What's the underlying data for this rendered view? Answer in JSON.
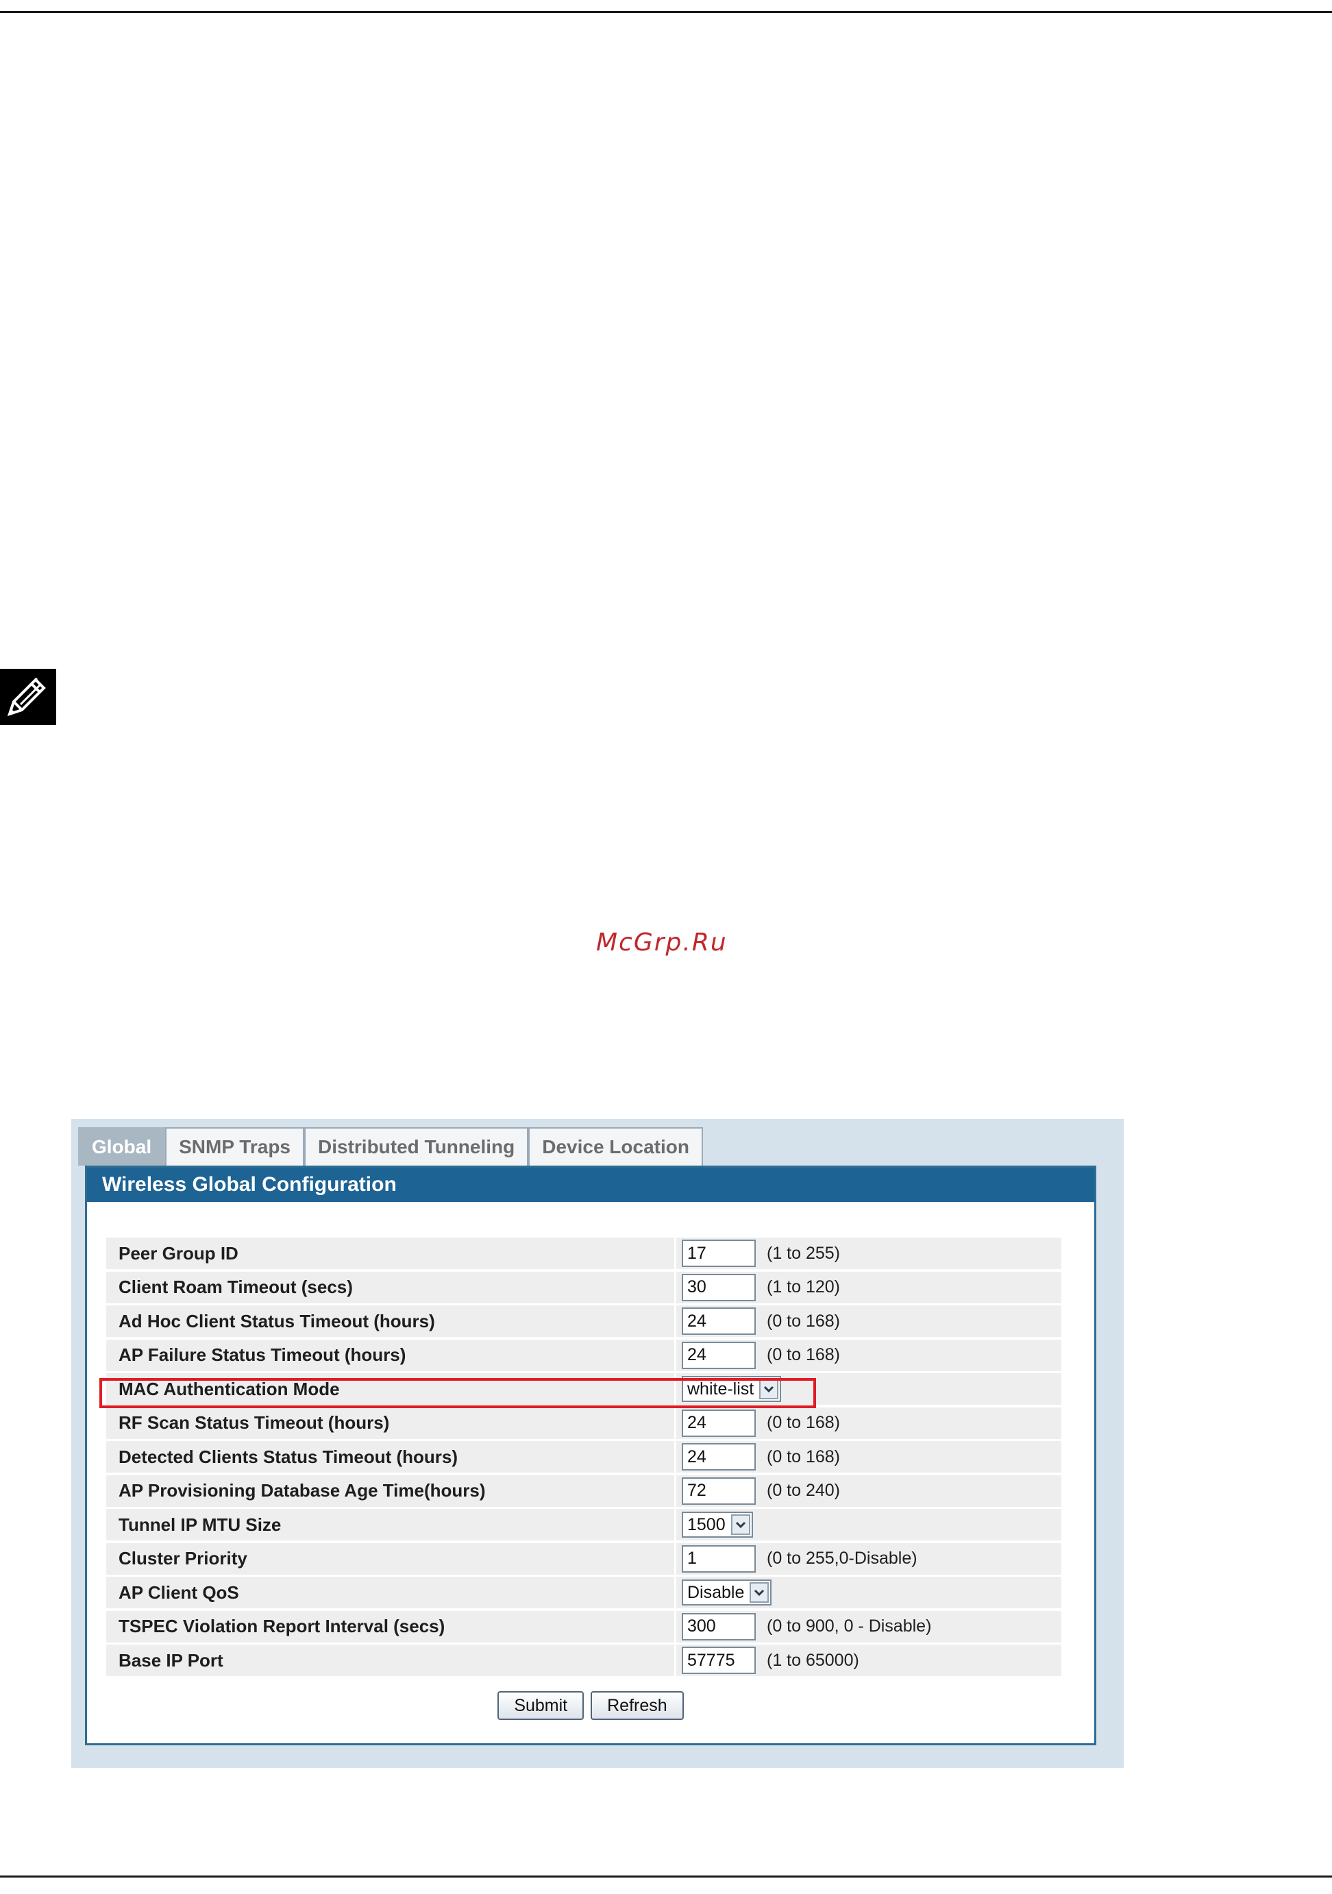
{
  "watermark": "McGrp.Ru",
  "tabs": [
    {
      "label": "Global",
      "active": true
    },
    {
      "label": "SNMP Traps",
      "active": false
    },
    {
      "label": "Distributed Tunneling",
      "active": false
    },
    {
      "label": "Device Location",
      "active": false
    }
  ],
  "panel": {
    "title": "Wireless Global Configuration"
  },
  "rows": [
    {
      "label": "Peer Group ID",
      "type": "text",
      "value": "17",
      "range": "(1 to 255)"
    },
    {
      "label": "Client Roam Timeout (secs)",
      "type": "text",
      "value": "30",
      "range": "(1 to 120)"
    },
    {
      "label": "Ad Hoc Client Status Timeout (hours)",
      "type": "text",
      "value": "24",
      "range": "(0 to 168)"
    },
    {
      "label": "AP Failure Status Timeout (hours)",
      "type": "text",
      "value": "24",
      "range": "(0 to 168)"
    },
    {
      "label": "MAC Authentication Mode",
      "type": "select",
      "value": "white-list",
      "range": ""
    },
    {
      "label": "RF Scan Status Timeout (hours)",
      "type": "text",
      "value": "24",
      "range": "(0 to 168)"
    },
    {
      "label": "Detected Clients Status Timeout (hours)",
      "type": "text",
      "value": "24",
      "range": "(0 to 168)"
    },
    {
      "label": "AP Provisioning Database Age Time(hours)",
      "type": "text",
      "value": "72",
      "range": "(0 to 240)"
    },
    {
      "label": "Tunnel IP MTU Size",
      "type": "select",
      "value": "1500",
      "range": ""
    },
    {
      "label": "Cluster Priority",
      "type": "text",
      "value": "1",
      "range": "(0 to 255,0-Disable)"
    },
    {
      "label": "AP Client QoS",
      "type": "select",
      "value": "Disable",
      "range": ""
    },
    {
      "label": "TSPEC Violation Report Interval (secs)",
      "type": "text",
      "value": "300",
      "range": "(0 to 900, 0 - Disable)"
    },
    {
      "label": "Base IP Port",
      "type": "text",
      "value": "57775",
      "range": "(1 to 65000)"
    }
  ],
  "buttons": {
    "submit_label": "Submit",
    "refresh_label": "Refresh"
  },
  "colors": {
    "header_blue": "#1d6394",
    "highlight_red": "#e01c24",
    "watermark_red": "#c0282b"
  },
  "icons": {
    "note": "note-pencil-icon",
    "dropdown": "chevron-down-icon"
  }
}
